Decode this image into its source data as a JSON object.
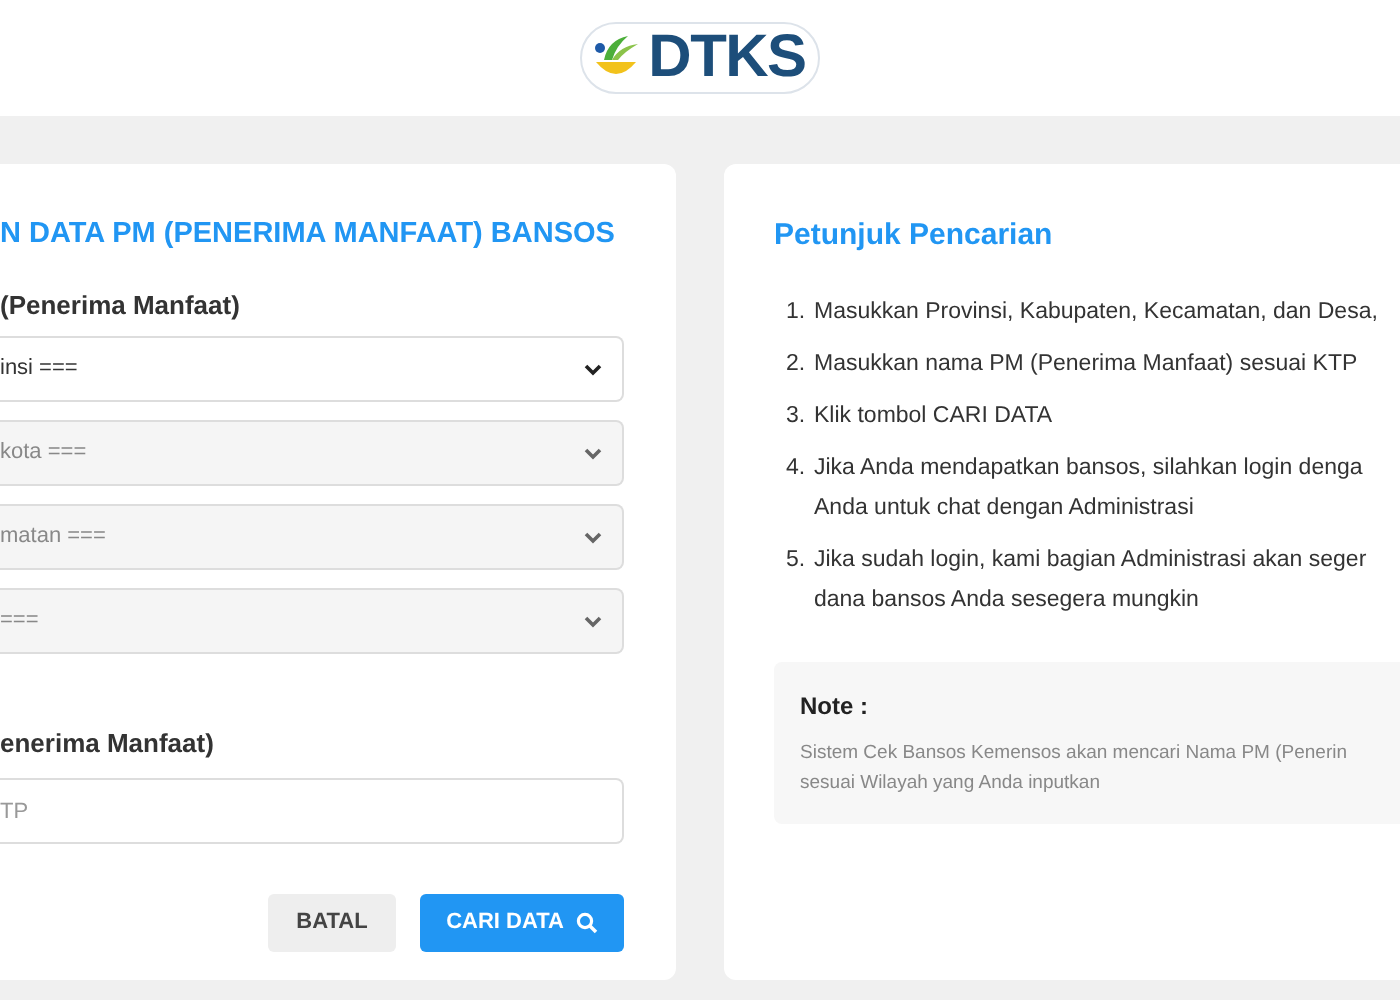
{
  "header": {
    "logo_text": "DTKS"
  },
  "search_form": {
    "title": "N DATA PM (PENERIMA MANFAAT) BANSOS",
    "region_label": "(Penerima Manfaat)",
    "selects": [
      {
        "value": "insi ===",
        "disabled": false
      },
      {
        "value": "kota ===",
        "disabled": true
      },
      {
        "value": "matan ===",
        "disabled": true
      },
      {
        "value": "===",
        "disabled": true
      }
    ],
    "name_label": "enerima Manfaat)",
    "name_input": {
      "placeholder": "TP"
    },
    "buttons": [
      {
        "label": "BATAL",
        "kind": "secondary"
      },
      {
        "label": "CARI DATA",
        "kind": "primary"
      }
    ]
  },
  "instructions": {
    "title": "Petunjuk Pencarian",
    "steps": [
      {
        "number": "1.",
        "lines": [
          "Masukkan Provinsi, Kabupaten, Kecamatan, dan Desa,"
        ]
      },
      {
        "number": "2.",
        "lines": [
          "Masukkan nama PM (Penerima Manfaat) sesuai KTP"
        ]
      },
      {
        "number": "3.",
        "lines": [
          "Klik tombol CARI DATA"
        ]
      },
      {
        "number": "4.",
        "lines": [
          "Jika Anda mendapatkan bansos, silahkan login denga",
          "Anda untuk chat dengan Administrasi"
        ]
      },
      {
        "number": "5.",
        "lines": [
          "Jika sudah login, kami bagian Administrasi akan seger",
          "dana bansos Anda sesegera mungkin"
        ]
      }
    ],
    "note": {
      "title": "Note :",
      "lines": [
        "Sistem Cek Bansos Kemensos akan mencari Nama PM (Penerin",
        "sesuai Wilayah yang Anda inputkan"
      ]
    }
  }
}
